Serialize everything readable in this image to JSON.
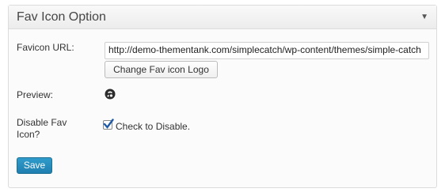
{
  "panel": {
    "title": "Fav Icon Option",
    "toggle_icon": "triangle-down-icon"
  },
  "favicon": {
    "label": "Favicon URL:",
    "url_value": "http://demo-thementank.com/simplecatch/wp-content/themes/simple-catch",
    "change_button": "Change Fav icon Logo"
  },
  "preview": {
    "label": "Preview:",
    "icon": "favicon-preview-icon"
  },
  "disable": {
    "label_line1": "Disable Fav",
    "label_line2": "Icon?",
    "checkbox_checked": true,
    "checkbox_label": "Check to Disable."
  },
  "save_button": "Save"
}
